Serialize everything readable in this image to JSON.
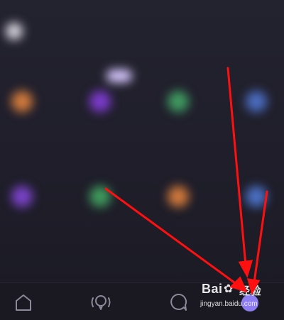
{
  "header": {
    "username": "",
    "right_link": ""
  },
  "apps_row1": [
    {
      "label": "",
      "color": "#d07a3c"
    },
    {
      "label": "",
      "color": "#7b3bcc"
    },
    {
      "label": "",
      "color": "#3f9a60"
    },
    {
      "label": "",
      "color": "#4a6cc0"
    }
  ],
  "apps_row2": [
    {
      "label": "",
      "color": "#7a43c8"
    },
    {
      "label": "",
      "color": "#3f9a5c"
    },
    {
      "label": "",
      "color": "#d0783a"
    },
    {
      "label": "",
      "color": "#4a70c4"
    }
  ],
  "bottom_nav": {
    "items": [
      {
        "icon": "home-icon"
      },
      {
        "icon": "discover-icon"
      },
      {
        "icon": "message-icon"
      },
      {
        "icon": "profile-avatar-icon"
      }
    ]
  },
  "watermark": {
    "logo": "Bai",
    "logo_suffix": "经验",
    "url": "jingyan.baidu.com"
  },
  "annotation": {
    "arrow_color": "#ff1010"
  }
}
